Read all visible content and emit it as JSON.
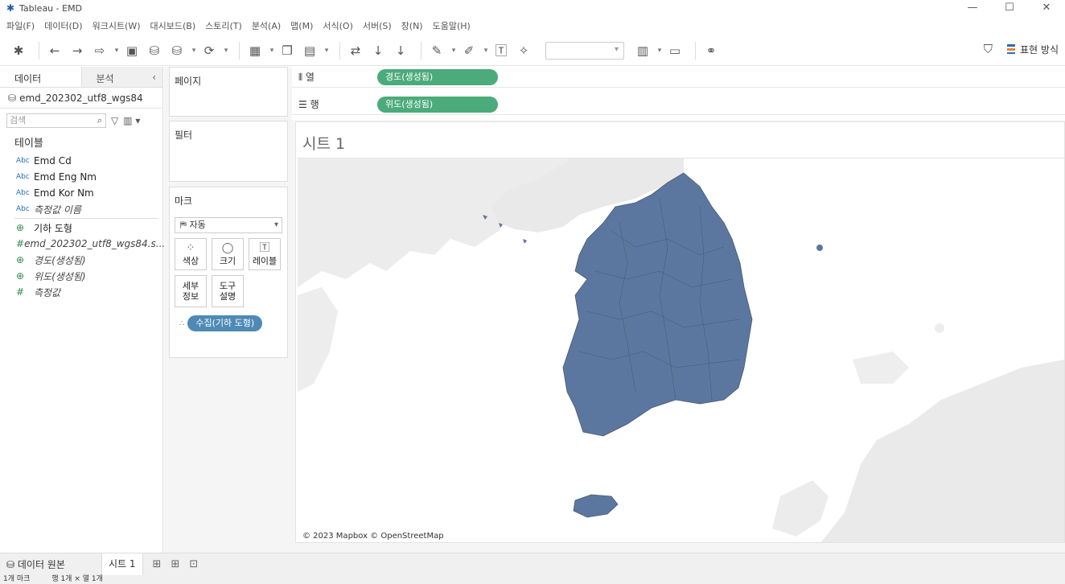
{
  "window": {
    "title": "Tableau - EMD"
  },
  "menu": [
    "파일(F)",
    "데이터(D)",
    "워크시트(W)",
    "대시보드(B)",
    "스토리(T)",
    "분석(A)",
    "맵(M)",
    "서식(O)",
    "서버(S)",
    "창(N)",
    "도움말(H)"
  ],
  "toolbar": {
    "show_me_label": "표현 방식"
  },
  "data_pane": {
    "tab_data": "데이터",
    "tab_analysis": "분석",
    "source": "emd_202302_utf8_wgs84",
    "search_placeholder": "검색",
    "section_title": "테이블",
    "fields": [
      {
        "type": "Abc",
        "name": "Emd Cd"
      },
      {
        "type": "Abc",
        "name": "Emd Eng Nm"
      },
      {
        "type": "Abc",
        "name": "Emd Kor Nm"
      },
      {
        "type": "Abc",
        "name": "측정값 이름"
      },
      {
        "type": "geo",
        "name": "기하 도형"
      },
      {
        "type": "#",
        "name": "emd_202302_utf8_wgs84.s..."
      },
      {
        "type": "geo",
        "name": "경도(생성됨)"
      },
      {
        "type": "geo",
        "name": "위도(생성됨)"
      },
      {
        "type": "#",
        "name": "측정값"
      }
    ]
  },
  "cards": {
    "pages": "페이지",
    "filters": "필터",
    "marks": "마크",
    "mark_type": "자동",
    "buttons": {
      "color": "색상",
      "size": "크기",
      "label": "레이블",
      "detail_1": "세부",
      "detail_2": "정보",
      "tooltip_1": "도구",
      "tooltip_2": "설명"
    },
    "mark_pill": "수집(기하 도형)"
  },
  "shelves": {
    "columns_label": "열",
    "rows_label": "행",
    "columns_pill": "경도(생성됨)",
    "rows_pill": "위도(생성됨)"
  },
  "view": {
    "sheet_title": "시트 1",
    "attribution": "© 2023 Mapbox © OpenStreetMap",
    "mark_color": "#5b77a0"
  },
  "tabs": {
    "data_source": "데이터 원본",
    "sheet": "시트 1"
  },
  "status": {
    "marks": "1개 마크",
    "rows_cols": "행 1개 × 열 1개"
  }
}
